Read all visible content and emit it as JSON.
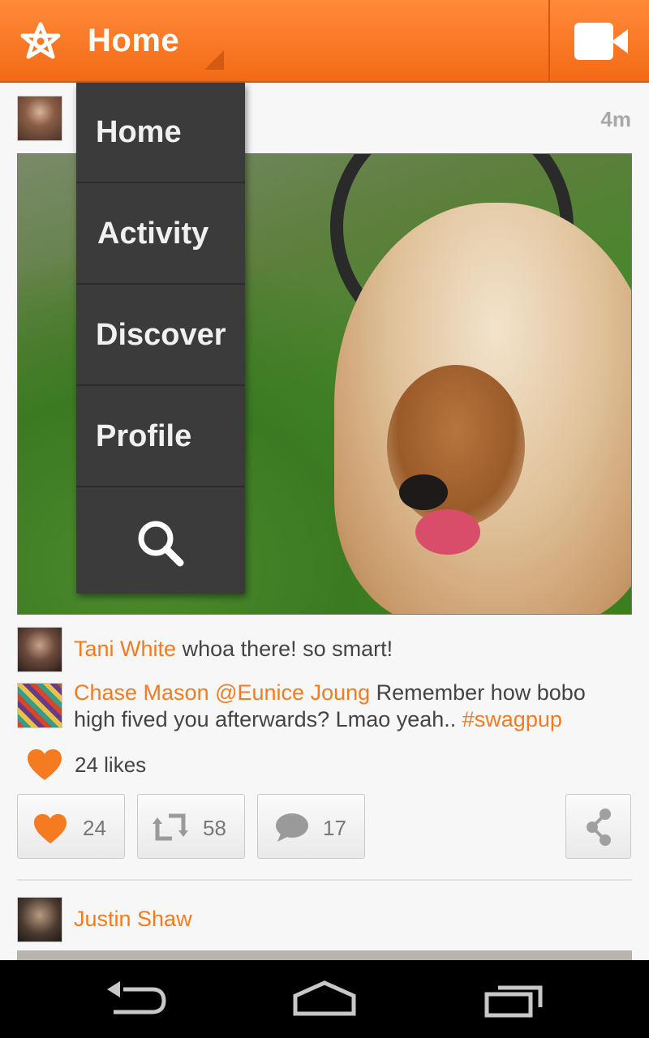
{
  "app_bar": {
    "title": "Home",
    "logo_icon": "vine-flower-icon",
    "camera_icon": "video-camera-icon",
    "accent_color": "#f47b20"
  },
  "dropdown": {
    "items": [
      {
        "label": "Home"
      },
      {
        "label": "Activity"
      },
      {
        "label": "Discover"
      },
      {
        "label": "Profile"
      }
    ],
    "search_icon": "search-icon"
  },
  "post": {
    "time": "4m",
    "comments": [
      {
        "name": "Tani White",
        "text": " whoa there! so smart!"
      },
      {
        "name": "Chase Mason",
        "mention": "@Eunice Joung",
        "text": " Remember how bobo high fived you afterwards? Lmao yeah.. ",
        "hashtag": "#swagpup"
      }
    ],
    "likes_text": "24 likes",
    "actions": {
      "like_count": "24",
      "revine_count": "58",
      "comment_count": "17"
    }
  },
  "next_post": {
    "name": "Justin Shaw"
  },
  "navbar": {
    "icons": [
      "back-icon",
      "home-icon",
      "recent-apps-icon"
    ]
  }
}
